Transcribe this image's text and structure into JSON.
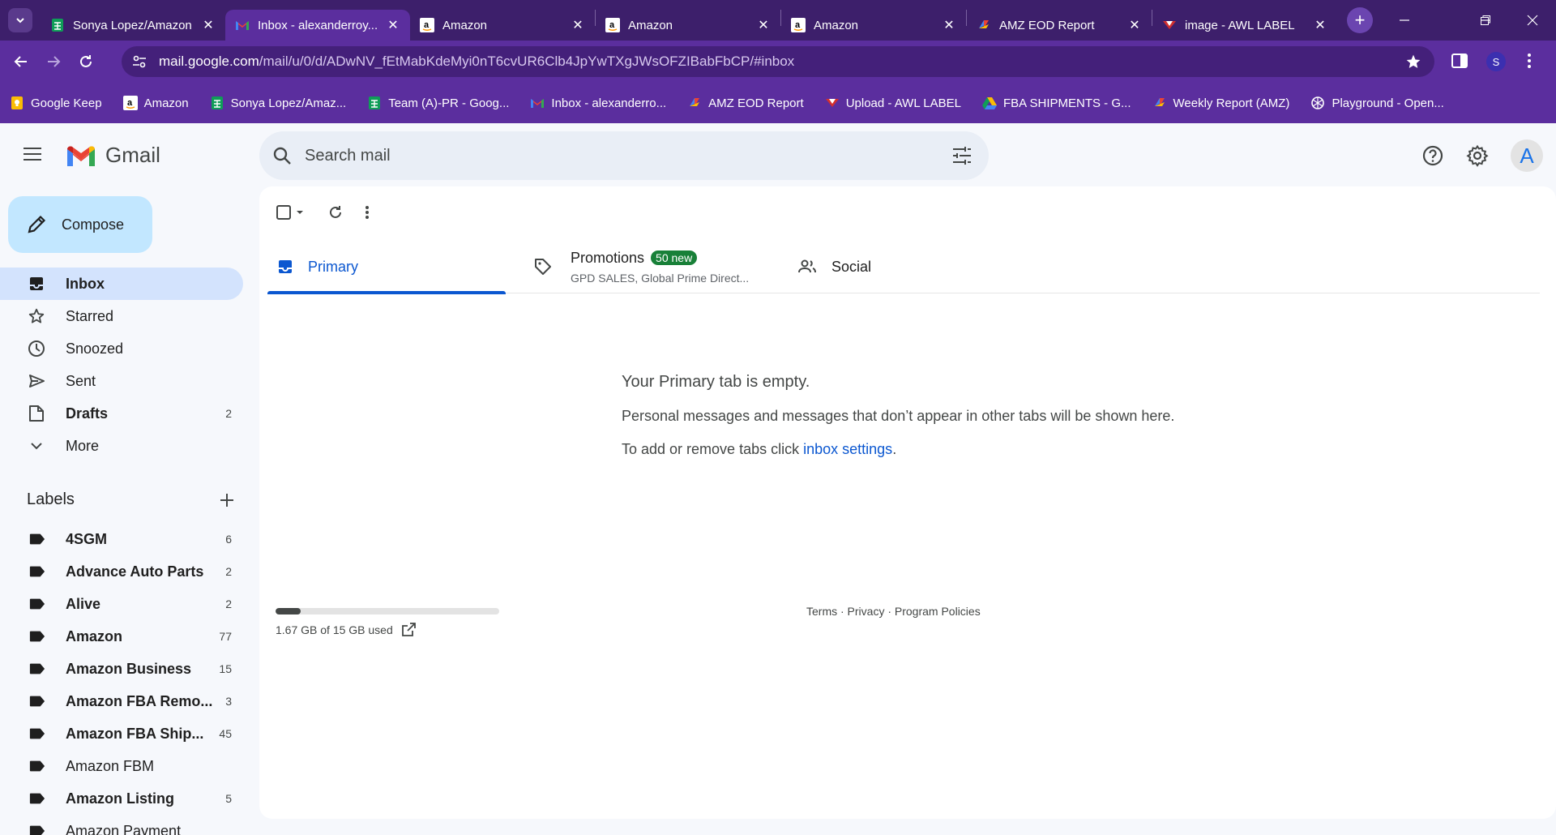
{
  "browser": {
    "tabs": [
      {
        "title": "Sonya Lopez/Amazon",
        "favicon": "sheets-icon",
        "active": false
      },
      {
        "title": "Inbox - alexanderroy...",
        "favicon": "gmail-icon",
        "active": true
      },
      {
        "title": "Amazon",
        "favicon": "amazon-icon",
        "active": false
      },
      {
        "title": "Amazon",
        "favicon": "amazon-icon",
        "active": false
      },
      {
        "title": "Amazon",
        "favicon": "amazon-icon",
        "active": false
      },
      {
        "title": "AMZ EOD Report",
        "favicon": "appsheet-icon",
        "active": false
      },
      {
        "title": "image - AWL LABEL",
        "favicon": "awl-icon",
        "active": false
      }
    ],
    "url_host": "mail.google.com",
    "url_path": "/mail/u/0/d/ADwNV_fEtMabKdeMyi0nT6cvUR6Clb4JpYwTXgJWsOFZIBabFbCP/#inbox",
    "profile_initial": "S",
    "bookmarks": [
      {
        "label": "Google Keep",
        "icon": "keep-icon"
      },
      {
        "label": "Amazon",
        "icon": "amazon-icon"
      },
      {
        "label": "Sonya Lopez/Amaz...",
        "icon": "sheets-icon"
      },
      {
        "label": "Team (A)-PR - Goog...",
        "icon": "sheets-icon"
      },
      {
        "label": "Inbox - alexanderro...",
        "icon": "gmail-icon"
      },
      {
        "label": "AMZ EOD Report",
        "icon": "appsheet-icon"
      },
      {
        "label": "Upload - AWL LABEL",
        "icon": "awl-icon"
      },
      {
        "label": "FBA SHIPMENTS - G...",
        "icon": "drive-icon"
      },
      {
        "label": "Weekly Report (AMZ)",
        "icon": "appsheet-icon"
      },
      {
        "label": "Playground - Open...",
        "icon": "openai-icon"
      }
    ]
  },
  "gmail": {
    "logo_text": "Gmail",
    "search_placeholder": "Search mail",
    "avatar_initial": "A",
    "compose_label": "Compose",
    "nav": [
      {
        "label": "Inbox",
        "icon": "inbox-icon",
        "count": "",
        "active": true,
        "bold": true
      },
      {
        "label": "Starred",
        "icon": "star-icon",
        "count": "",
        "active": false,
        "bold": false
      },
      {
        "label": "Snoozed",
        "icon": "clock-icon",
        "count": "",
        "active": false,
        "bold": false
      },
      {
        "label": "Sent",
        "icon": "send-icon",
        "count": "",
        "active": false,
        "bold": false
      },
      {
        "label": "Drafts",
        "icon": "draft-icon",
        "count": "2",
        "active": false,
        "bold": true
      },
      {
        "label": "More",
        "icon": "chevron-down-icon",
        "count": "",
        "active": false,
        "bold": false
      }
    ],
    "labels_heading": "Labels",
    "labels": [
      {
        "label": "4SGM",
        "count": "6",
        "bold": true
      },
      {
        "label": "Advance Auto Parts",
        "count": "2",
        "bold": true
      },
      {
        "label": "Alive",
        "count": "2",
        "bold": true
      },
      {
        "label": "Amazon",
        "count": "77",
        "bold": true
      },
      {
        "label": "Amazon Business",
        "count": "15",
        "bold": true
      },
      {
        "label": "Amazon FBA Remo...",
        "count": "3",
        "bold": true
      },
      {
        "label": "Amazon FBA Ship...",
        "count": "45",
        "bold": true
      },
      {
        "label": "Amazon FBM",
        "count": "",
        "bold": false
      },
      {
        "label": "Amazon Listing",
        "count": "5",
        "bold": true
      },
      {
        "label": "Amazon Payment",
        "count": "",
        "bold": false
      }
    ],
    "tabs": {
      "primary": "Primary",
      "promotions": "Promotions",
      "promotions_badge": "50 new",
      "promotions_sub": "GPD SALES, Global Prime Direct...",
      "social": "Social"
    },
    "empty_title": "Your Primary tab is empty.",
    "empty_body": "Personal messages and messages that don’t appear in other tabs will be shown here.",
    "empty_settings_prefix": "To add or remove tabs click ",
    "empty_settings_link": "inbox settings",
    "empty_settings_suffix": ".",
    "storage_text": "1.67 GB of 15 GB used",
    "storage_fraction": 0.111,
    "footer": "Terms · Privacy · Program Policies"
  }
}
